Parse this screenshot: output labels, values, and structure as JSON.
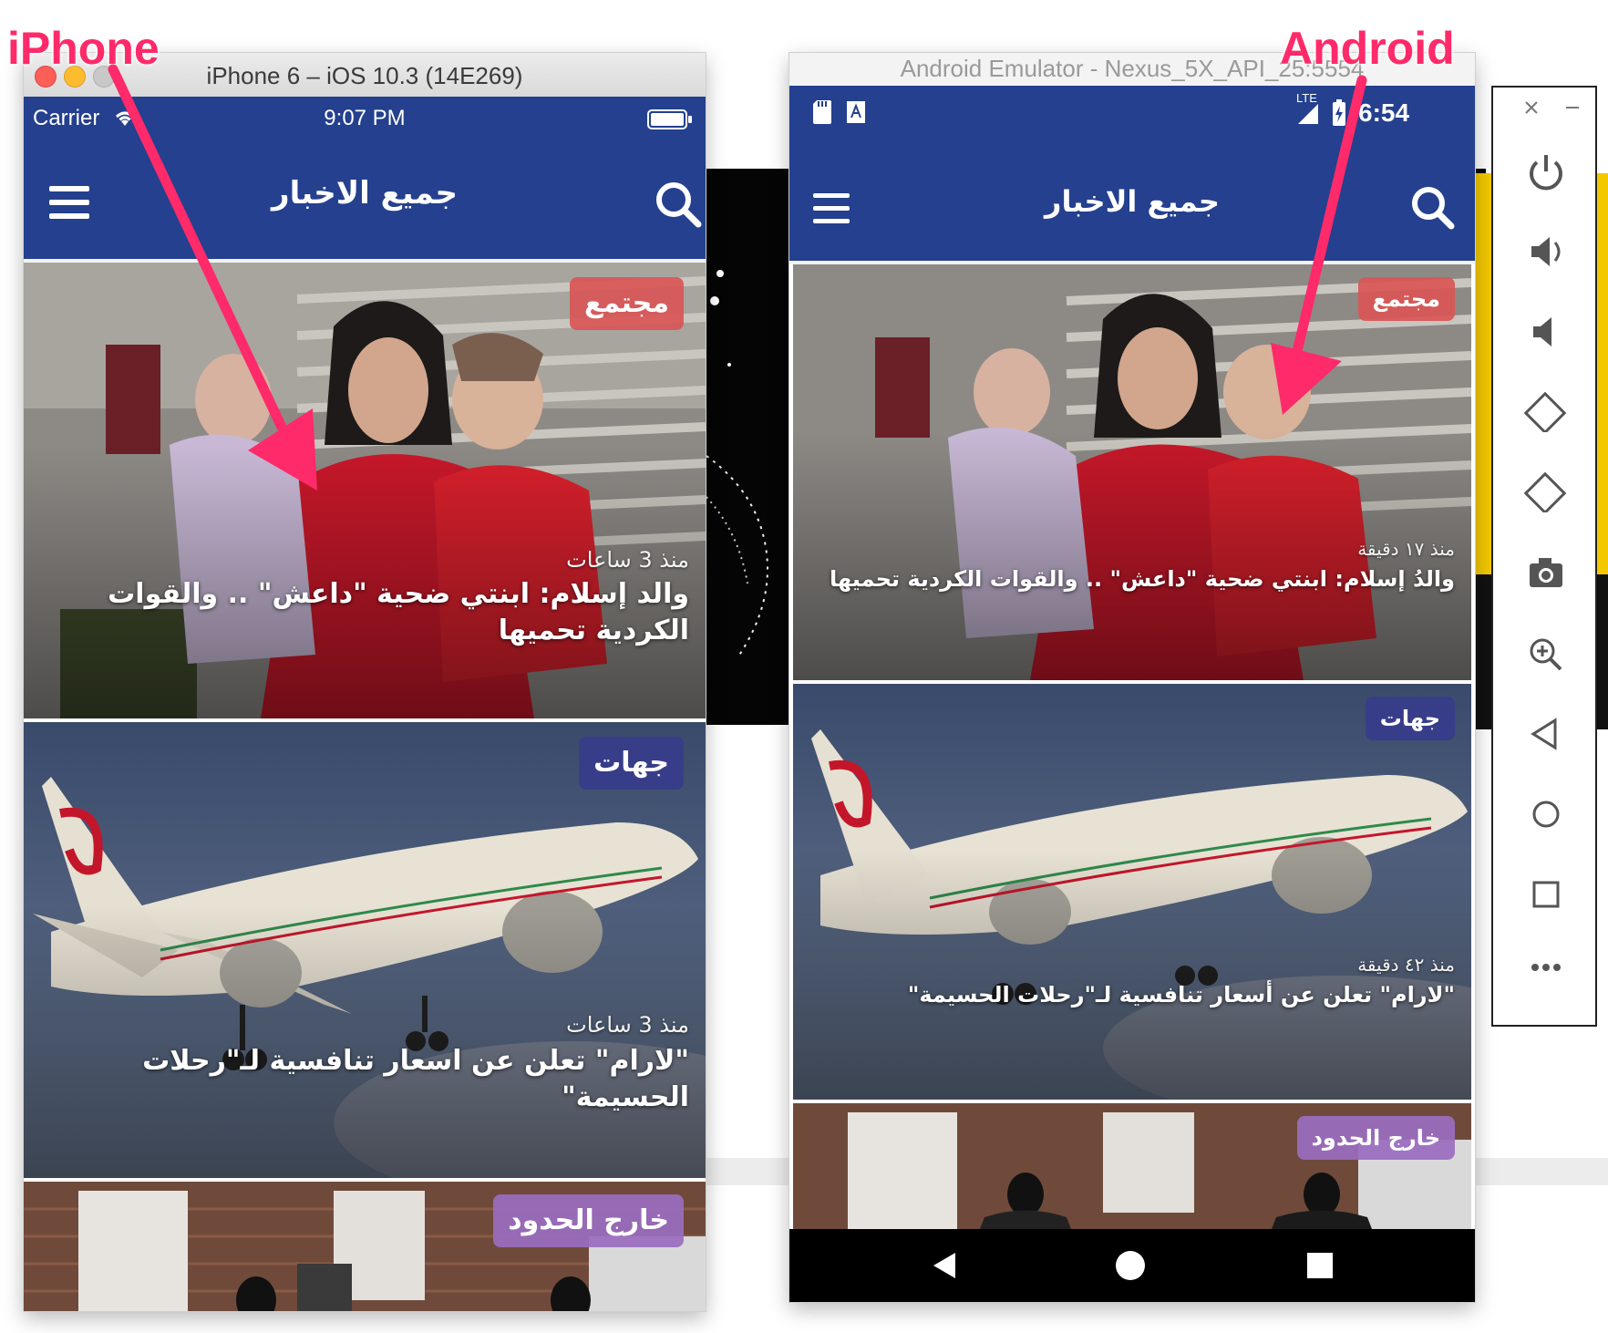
{
  "iphone_window": {
    "title": "iPhone 6 – iOS 10.3 (14E269)",
    "status": {
      "carrier": "Carrier",
      "time": "9:07 PM"
    },
    "app_title": "جميع الاخبار",
    "cards": [
      {
        "category": "مجتمع",
        "time": "منذ 3 ساعات",
        "headline": "والد إسلام: ابنتي ضحية \"داعش\" .. والقوات الكردية تحميها"
      },
      {
        "category": "جهات",
        "time": "منذ 3 ساعات",
        "headline": "\"لارام\" تعلن عن اسعار تنافسية لـ\"رحلات الحسيمة\""
      },
      {
        "category": "خارج الحدود"
      }
    ]
  },
  "android_window": {
    "title": "Android Emulator - Nexus_5X_API_25:5554",
    "status": {
      "network": "LTE",
      "time": "6:54"
    },
    "app_title": "جميع الاخبار",
    "cards": [
      {
        "category": "مجتمع",
        "time": "منذ ١٧ دقيقة",
        "headline": "والدُ إسلام: ابنتي ضحية \"داعش\" .. والقوات الكردية تحميها"
      },
      {
        "category": "جهات",
        "time": "منذ ٤٢ دقيقة",
        "headline": "\"لارام\" تعلن عن أسعار تنافسية لـ\"رحلات الحسيمة\""
      },
      {
        "category": "خارج الحدود"
      }
    ]
  },
  "annotations": {
    "iphone_label": "iPhone",
    "android_label": "Android"
  },
  "emulator_controls": [
    "close-icon",
    "minimize-icon",
    "power-icon",
    "volume-up-icon",
    "volume-down-icon",
    "rotate-left-icon",
    "rotate-right-icon",
    "camera-icon",
    "zoom-icon",
    "back-icon",
    "home-icon",
    "overview-icon",
    "more-icon"
  ],
  "colors": {
    "app_bar": "#24408e",
    "annotation": "#ff2a6a",
    "badge_society": "#d95656",
    "badge_regions": "#3b3f8a",
    "badge_abroad": "#9a6cc0"
  }
}
